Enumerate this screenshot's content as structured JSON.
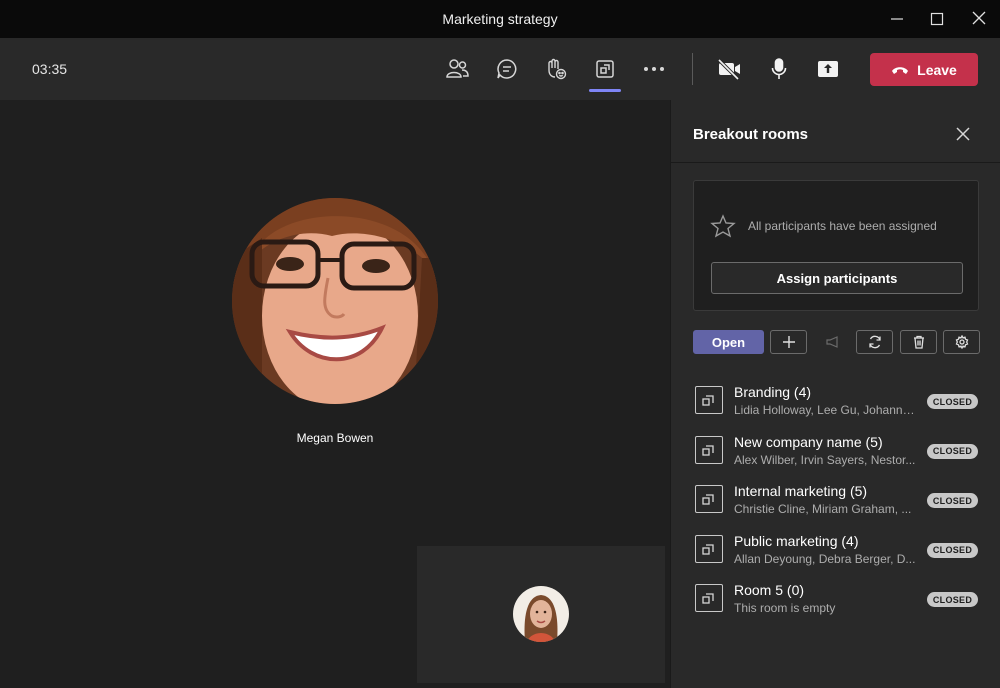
{
  "window": {
    "title": "Marketing strategy"
  },
  "toolbar": {
    "timer": "03:35",
    "icons": [
      "people-icon",
      "chat-icon",
      "raise-hand-icon",
      "breakout-rooms-icon",
      "more-options-icon",
      "camera-off-icon",
      "microphone-icon",
      "share-screen-icon"
    ],
    "leave_label": "Leave",
    "accent_color": "#7f85f5",
    "leave_color": "#c4314b"
  },
  "stage": {
    "main_participant": {
      "name": "Megan Bowen"
    }
  },
  "panel": {
    "title": "Breakout rooms",
    "assign_message": "All participants have been assigned",
    "assign_button": "Assign participants",
    "open_button": "Open",
    "open_button_color": "#6264a7",
    "rooms": [
      {
        "name": "Branding (4)",
        "people": "Lidia Holloway, Lee Gu, Johanna...",
        "status": "CLOSED"
      },
      {
        "name": "New company name (5)",
        "people": "Alex Wilber, Irvin Sayers, Nestor...",
        "status": "CLOSED"
      },
      {
        "name": "Internal marketing (5)",
        "people": "Christie Cline, Miriam Graham, ...",
        "status": "CLOSED"
      },
      {
        "name": "Public marketing (4)",
        "people": "Allan Deyoung, Debra Berger, D...",
        "status": "CLOSED"
      },
      {
        "name": "Room 5 (0)",
        "people": "This room is empty",
        "status": "CLOSED"
      }
    ]
  }
}
